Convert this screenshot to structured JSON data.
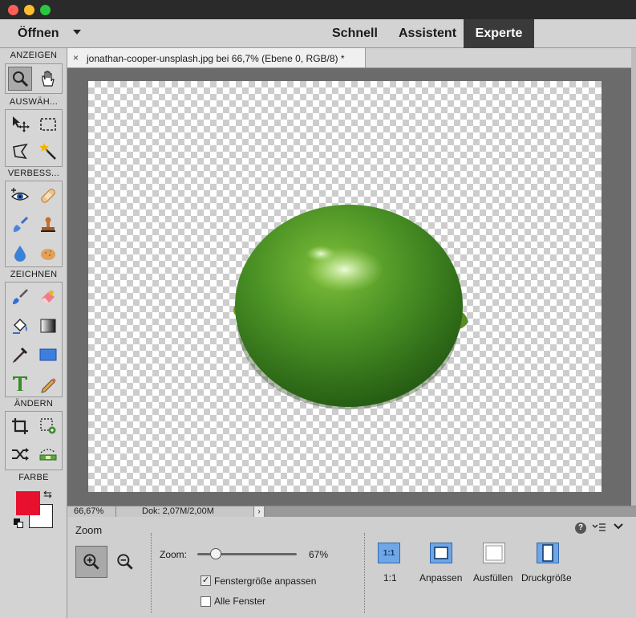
{
  "menu": {
    "open_label": "Öffnen",
    "modes": [
      "Schnell",
      "Assistent",
      "Experte"
    ],
    "active_mode": "Experte"
  },
  "toolbox": {
    "sections": [
      "ANZEIGEN",
      "AUSWÄH...",
      "VERBESS...",
      "ZEICHNEN",
      "ÄNDERN",
      "FARBE"
    ],
    "foreground_color": "#e8102f",
    "background_color": "#ffffff"
  },
  "document": {
    "tab_close": "×",
    "tab_title": "jonathan-cooper-unsplash.jpg bei 66,7% (Ebene 0, RGB/8) *"
  },
  "status": {
    "zoom": "66,67%",
    "doc_info": "Dok: 2,07M/2,00M",
    "arrow": "›"
  },
  "options": {
    "title": "Zoom",
    "zoom_label": "Zoom:",
    "zoom_value": "67%",
    "zoom_fraction": 0.67,
    "fit_window_label": "Fenstergröße anpassen",
    "fit_window_checked": true,
    "all_windows_label": "Alle Fenster",
    "all_windows_checked": false,
    "check_mark": "✓",
    "btn_1to1_icon_text": "1:1",
    "btn_1to1_label": "1:1",
    "btn_fit_label": "Anpassen",
    "btn_fill_label": "Ausfüllen",
    "btn_print_label": "Druckgröße",
    "help": "?"
  }
}
